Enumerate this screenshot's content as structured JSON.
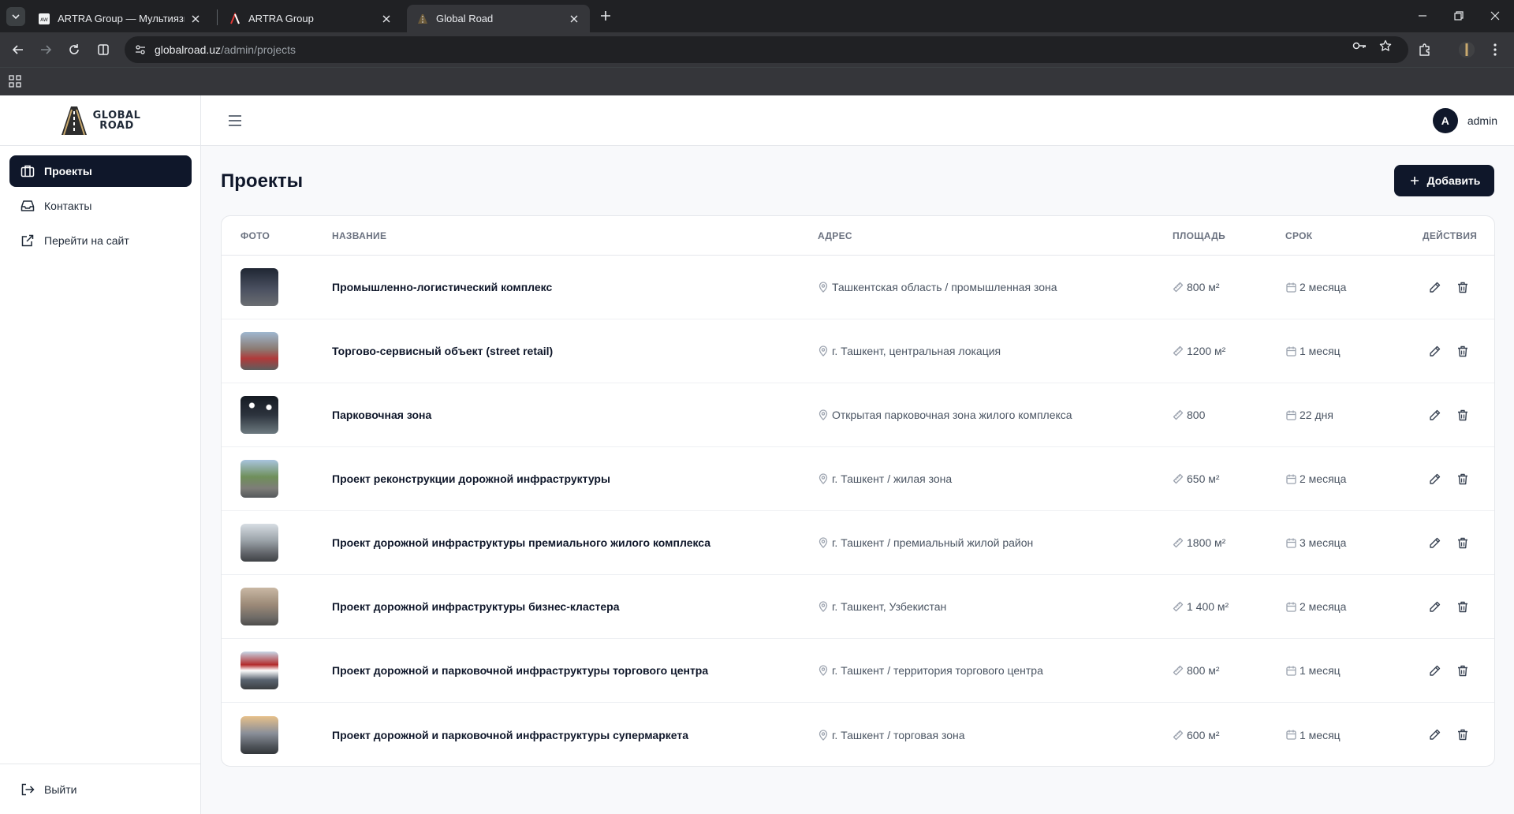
{
  "browser": {
    "tabs": [
      {
        "title": "ARTRA Group — Мультиязычн",
        "favicon": "artra-square-icon"
      },
      {
        "title": "ARTRA Group",
        "favicon": "artra-a-icon"
      },
      {
        "title": "Global Road",
        "favicon": "global-road-icon",
        "active": true
      }
    ],
    "url_host": "globalroad.uz",
    "url_path": "/admin/projects"
  },
  "sidebar": {
    "logo_line1": "GLOBAL",
    "logo_line2": "ROAD",
    "items": [
      {
        "label": "Проекты",
        "icon": "briefcase-icon",
        "active": true
      },
      {
        "label": "Контакты",
        "icon": "inbox-icon"
      },
      {
        "label": "Перейти на сайт",
        "icon": "external-link-icon"
      }
    ],
    "logout_label": "Выйти"
  },
  "topbar": {
    "avatar_letter": "A",
    "username": "admin"
  },
  "page": {
    "title": "Проекты",
    "add_label": "Добавить"
  },
  "table": {
    "headers": {
      "photo": "ФОТО",
      "name": "НАЗВАНИЕ",
      "address": "АДРЕС",
      "area": "ПЛОЩАДЬ",
      "term": "СРОК",
      "actions": "ДЕЙСТВИЯ"
    },
    "rows": [
      {
        "name": "Промышленно-логистический комплекс",
        "address": "Ташкентская область / промышленная зона",
        "area": "800 м²",
        "term": "2 месяца"
      },
      {
        "name": "Торгово-сервисный объект (street retail)",
        "address": "г. Ташкент, центральная локация",
        "area": "1200 м²",
        "term": "1 месяц"
      },
      {
        "name": "Парковочная зона",
        "address": "Открытая парковочная зона жилого комплекса",
        "area": "800",
        "term": "22 дня"
      },
      {
        "name": "Проект реконструкции дорожной инфраструктуры",
        "address": "г. Ташкент / жилая зона",
        "area": "650 м²",
        "term": "2 месяца"
      },
      {
        "name": "Проект дорожной инфраструктуры премиального жилого комплекса",
        "address": "г. Ташкент / премиальный жилой район",
        "area": "1800 м²",
        "term": "3 месяца"
      },
      {
        "name": "Проект дорожной инфраструктуры бизнес-кластера",
        "address": "г. Ташкент, Узбекистан",
        "area": "1 400 м²",
        "term": "2 месяца"
      },
      {
        "name": "Проект дорожной и парковочной инфраструктуры торгового центра",
        "address": "г. Ташкент / территория торгового центра",
        "area": "800 м²",
        "term": "1 месяц"
      },
      {
        "name": "Проект дорожной и парковочной инфраструктуры супермаркета",
        "address": "г. Ташкент / торговая зона",
        "area": "600 м²",
        "term": "1 месяц"
      }
    ]
  },
  "colors": {
    "primary": "#0f172a",
    "chrome_dark": "#202124",
    "chrome_mid": "#35363a"
  }
}
